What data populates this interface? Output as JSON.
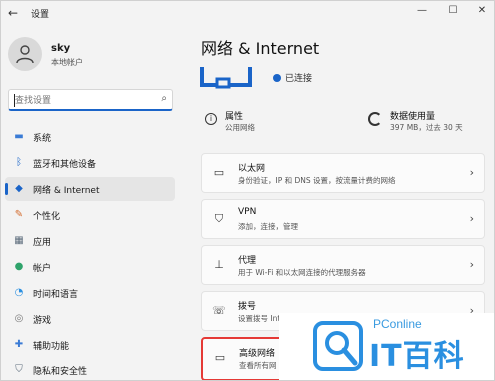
{
  "app": {
    "title": "设置"
  },
  "user": {
    "name": "sky",
    "account_type": "本地帐户"
  },
  "search": {
    "placeholder": "查找设置"
  },
  "nav": [
    {
      "label": "系统",
      "icon": "monitor-icon",
      "color": "#3a7bd5"
    },
    {
      "label": "蓝牙和其他设备",
      "icon": "bluetooth-icon",
      "color": "#1a64c8"
    },
    {
      "label": "网络 & Internet",
      "icon": "wifi-icon",
      "color": "#1a64c8",
      "active": true
    },
    {
      "label": "个性化",
      "icon": "brush-icon",
      "color": "#d36b2d"
    },
    {
      "label": "应用",
      "icon": "apps-icon",
      "color": "#5b6b7b"
    },
    {
      "label": "帐户",
      "icon": "person-icon",
      "color": "#2fa36b"
    },
    {
      "label": "时间和语言",
      "icon": "globe-clock-icon",
      "color": "#2a8fe0"
    },
    {
      "label": "游戏",
      "icon": "gamepad-icon",
      "color": "#777777"
    },
    {
      "label": "辅助功能",
      "icon": "accessibility-icon",
      "color": "#3a7bd5"
    },
    {
      "label": "隐私和安全性",
      "icon": "shield-icon",
      "color": "#5b6b7b"
    }
  ],
  "main": {
    "title": "网络 & Internet",
    "status": "已连接",
    "properties": {
      "title": "属性",
      "subtitle": "公用网络"
    },
    "usage": {
      "title": "数据使用量",
      "subtitle": "397 MB，过去 30 天"
    },
    "cards": [
      {
        "title": "以太网",
        "subtitle": "身份验证，IP 和 DNS 设置，按流量计费的网络",
        "icon": "ethernet-icon"
      },
      {
        "title": "VPN",
        "subtitle": "添加，连接，管理",
        "icon": "vpn-shield-icon"
      },
      {
        "title": "代理",
        "subtitle": "用于 Wi-Fi 和以太网连接的代理服务器",
        "icon": "proxy-icon"
      },
      {
        "title": "拨号",
        "subtitle": "设置拨号 Internet 连接",
        "icon": "dialup-icon"
      },
      {
        "title": "高级网络",
        "subtitle": "查看所有网",
        "icon": "advanced-network-icon"
      }
    ]
  },
  "watermark": {
    "brand_small": "PConline",
    "brand_big": "IT百科"
  },
  "colors": {
    "accent": "#1a64c8",
    "highlight": "#e53935"
  }
}
